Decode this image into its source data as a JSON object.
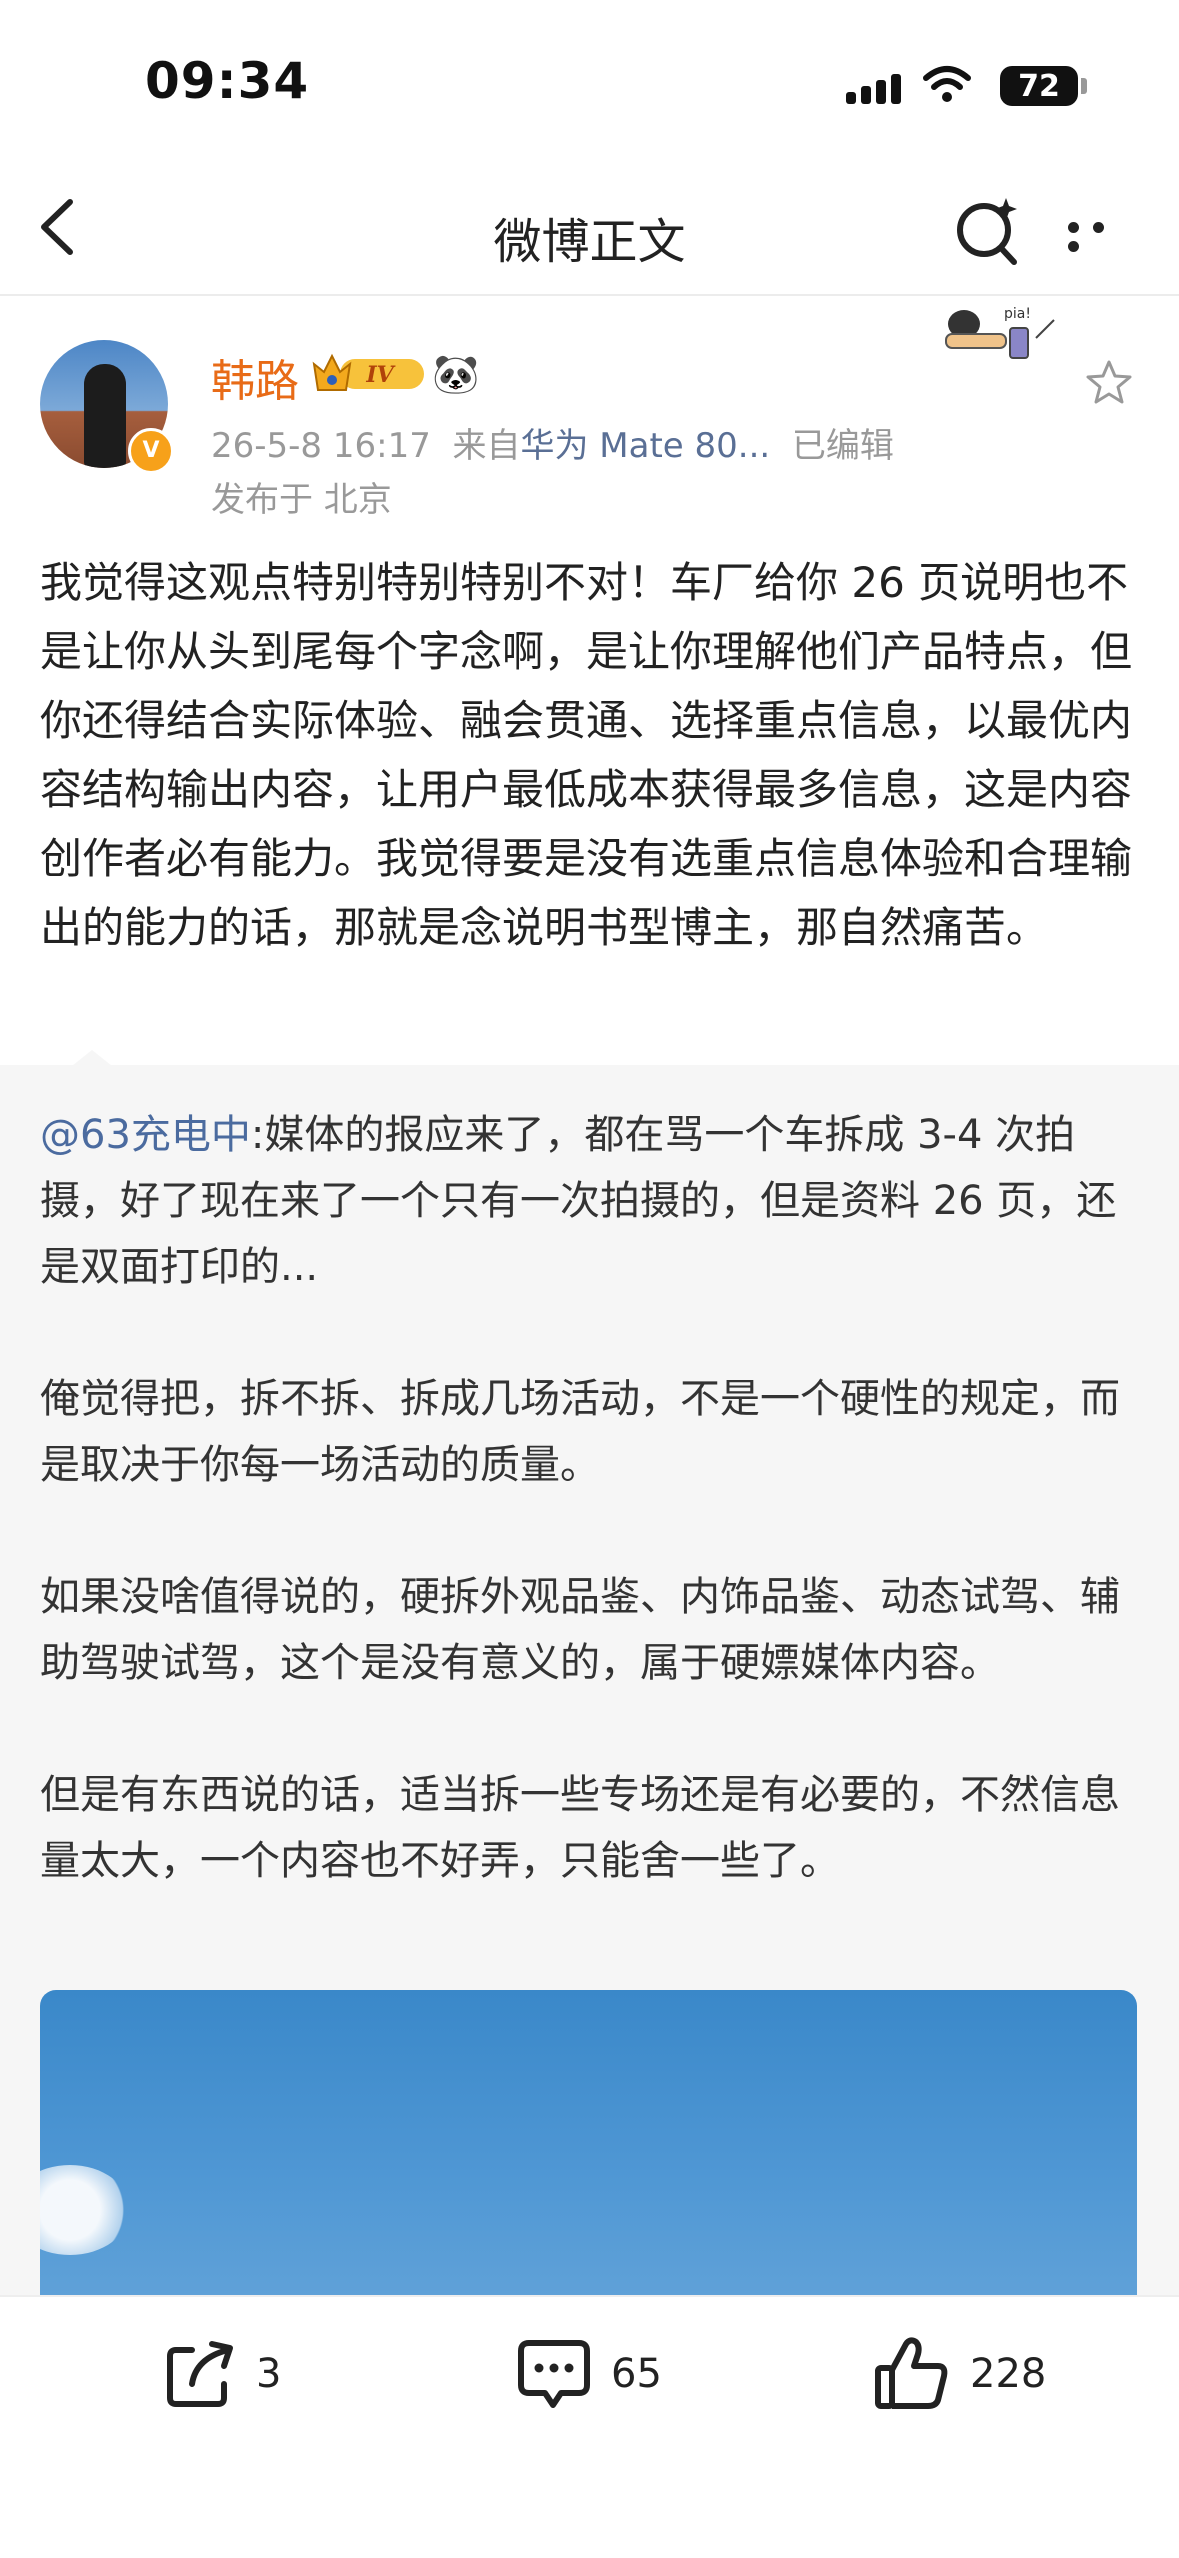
{
  "status_bar": {
    "time": "09:34",
    "battery": "72"
  },
  "nav": {
    "title": "微博正文",
    "back_icon": "chevron-left-icon",
    "search_icon": "search-sparkle-icon",
    "more_icon": "more-dots-icon"
  },
  "post": {
    "author": "韩路",
    "level_badge": "IV",
    "date": "26-5-8 16:17",
    "source_prefix": "来自",
    "device": "华为 Mate 80...",
    "edited": "已编辑",
    "location": "发布于 北京",
    "text": "我觉得这观点特别特别特别不对！车厂给你 26 页说明也不是让你从头到尾每个字念啊，是让你理解他们产品特点，但你还得结合实际体验、融会贯通、选择重点信息，以最优内容结构输出内容，让用户最低成本获得最多信息，这是内容创作者必有能力。我觉得要是没有选重点信息体验和合理输出的能力的话，那就是念说明书型博主，那自然痛苦。"
  },
  "repost": {
    "mention": "@63充电中",
    "p1": ":媒体的报应来了，都在骂一个车拆成 3-4 次拍摄，好了现在来了一个只有一次拍摄的，但是资料 26 页，还是双面打印的...",
    "p2": "俺觉得把，拆不拆、拆成几场活动，不是一个硬性的规定，而是取决于你每一场活动的质量。",
    "p3": "如果没啥值得说的，硬拆外观品鉴、内饰品鉴、动态试驾、辅助驾驶试驾，这个是没有意义的，属于硬嫖媒体内容。",
    "p4": "但是有东西说的话，适当拆一些专场还是有必要的，不然信息量太大，一个内容也不好弄，只能舍一些了。"
  },
  "actions": {
    "share": "3",
    "comments": "65",
    "likes": "228"
  },
  "colors": {
    "author": "#e86b17",
    "link": "#4b6b9f",
    "meta": "#999999"
  }
}
